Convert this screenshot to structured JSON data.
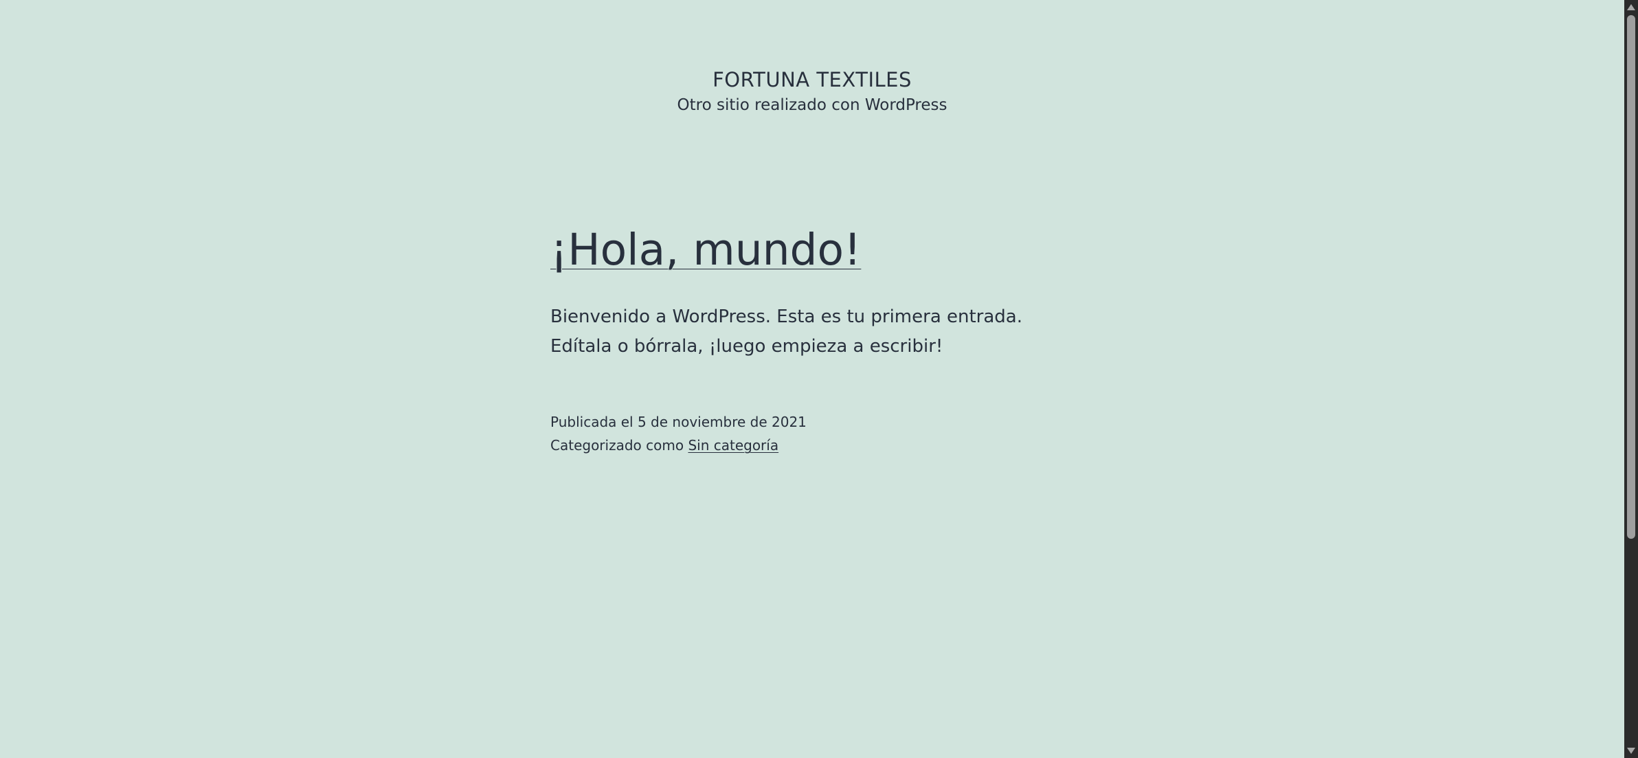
{
  "header": {
    "site_title": "FORTUNA TEXTILES",
    "site_description": "Otro sitio realizado con WordPress"
  },
  "post": {
    "title": "¡Hola, mundo!",
    "content": "Bienvenido a WordPress. Esta es tu primera entrada. Edítala o bórrala, ¡luego empieza a escribir!",
    "published_text": "Publicada el 5 de noviembre de 2021",
    "category_prefix": "Categorizado como",
    "category_link": "Sin categoría"
  },
  "colors": {
    "background": "#d1e4dd",
    "text": "#28303d",
    "scrollbar_track": "#2b2b2b",
    "scrollbar_thumb": "#9f9f9f"
  },
  "icons": {
    "scroll_up": "scroll-up-arrow-icon",
    "scroll_down": "scroll-down-arrow-icon"
  }
}
